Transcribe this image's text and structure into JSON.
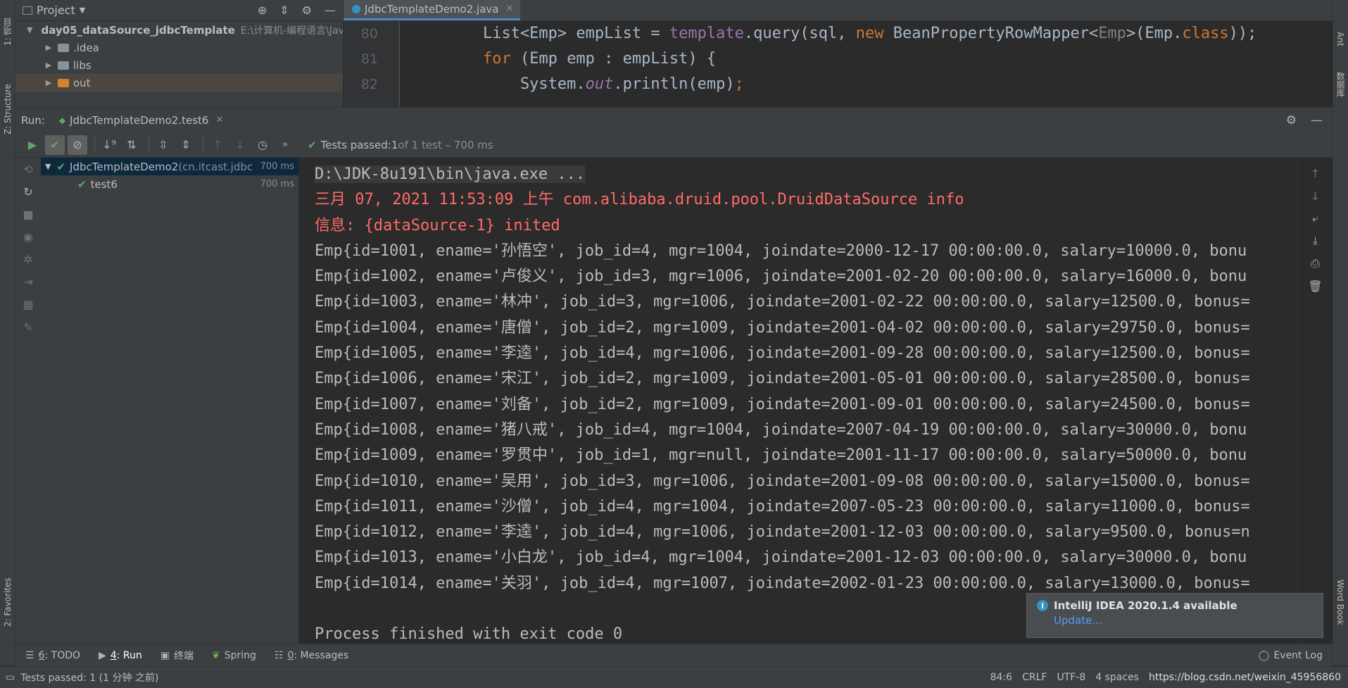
{
  "left_strip": {
    "project_tab": "1: 项目",
    "structure_tab": "Z: Structure",
    "favorites_tab": "2: Favorites"
  },
  "right_strip": {
    "ant_tab": "Ant",
    "database_tab": "数据库",
    "wordbook_tab": "Word Book"
  },
  "project": {
    "title": "Project",
    "tree": [
      {
        "label": "day05_dataSource_jdbcTemplate",
        "path": "E:\\计算机-编程语言\\Jav"
      },
      {
        "label": ".idea"
      },
      {
        "label": "libs"
      },
      {
        "label": "out"
      }
    ]
  },
  "editor": {
    "tab_label": "JdbcTemplateDemo2.java",
    "lines": [
      {
        "num": "80"
      },
      {
        "num": "81"
      },
      {
        "num": "82"
      }
    ]
  },
  "run": {
    "label": "Run:",
    "tab_label": "JdbcTemplateDemo2.test6",
    "status_prefix": "Tests passed: ",
    "status_count": "1",
    "status_suffix": " of 1 test – 700 ms",
    "tree": [
      {
        "label": "JdbcTemplateDemo2",
        "pkg": " (cn.itcast.jdbc",
        "duration": "700 ms"
      },
      {
        "label": "test6",
        "duration": "700 ms"
      }
    ]
  },
  "console": {
    "command": "D:\\JDK-8u191\\bin\\java.exe ...",
    "log_line1": "三月 07, 2021 11:53:09 上午 com.alibaba.druid.pool.DruidDataSource info",
    "log_line2": "信息: {dataSource-1} inited",
    "output": [
      "Emp{id=1001, ename='孙悟空', job_id=4, mgr=1004, joindate=2000-12-17 00:00:00.0, salary=10000.0, bonu",
      "Emp{id=1002, ename='卢俊义', job_id=3, mgr=1006, joindate=2001-02-20 00:00:00.0, salary=16000.0, bonu",
      "Emp{id=1003, ename='林冲', job_id=3, mgr=1006, joindate=2001-02-22 00:00:00.0, salary=12500.0, bonus=",
      "Emp{id=1004, ename='唐僧', job_id=2, mgr=1009, joindate=2001-04-02 00:00:00.0, salary=29750.0, bonus=",
      "Emp{id=1005, ename='李逵', job_id=4, mgr=1006, joindate=2001-09-28 00:00:00.0, salary=12500.0, bonus=",
      "Emp{id=1006, ename='宋江', job_id=2, mgr=1009, joindate=2001-05-01 00:00:00.0, salary=28500.0, bonus=",
      "Emp{id=1007, ename='刘备', job_id=2, mgr=1009, joindate=2001-09-01 00:00:00.0, salary=24500.0, bonus=",
      "Emp{id=1008, ename='猪八戒', job_id=4, mgr=1004, joindate=2007-04-19 00:00:00.0, salary=30000.0, bonu",
      "Emp{id=1009, ename='罗贯中', job_id=1, mgr=null, joindate=2001-11-17 00:00:00.0, salary=50000.0, bonu",
      "Emp{id=1010, ename='吴用', job_id=3, mgr=1006, joindate=2001-09-08 00:00:00.0, salary=15000.0, bonus=",
      "Emp{id=1011, ename='沙僧', job_id=4, mgr=1004, joindate=2007-05-23 00:00:00.0, salary=11000.0, bonus=",
      "Emp{id=1012, ename='李逵', job_id=4, mgr=1006, joindate=2001-12-03 00:00:00.0, salary=9500.0, bonus=n",
      "Emp{id=1013, ename='小白龙', job_id=4, mgr=1004, joindate=2001-12-03 00:00:00.0, salary=30000.0, bonu",
      "Emp{id=1014, ename='关羽', job_id=4, mgr=1007, joindate=2002-01-23 00:00:00.0, salary=13000.0, bonus="
    ],
    "finish": "Process finished with exit code 0"
  },
  "notification": {
    "title": "IntelliJ IDEA 2020.1.4 available",
    "link": "Update..."
  },
  "bottom_tabs": [
    {
      "key": "6",
      "label": ": TODO"
    },
    {
      "key": "4",
      "label": ": Run"
    },
    {
      "label": "终端"
    },
    {
      "label": "Spring"
    },
    {
      "key": "0",
      "label": ": Messages"
    },
    {
      "label": "Event Log"
    }
  ],
  "status_bar": {
    "left": "Tests passed: 1 (1 分钟 之前)",
    "position": "84:6",
    "line_sep": "CRLF",
    "encoding": "UTF-8",
    "indent": "4 spaces",
    "watermark": "https://blog.csdn.net/weixin_45956860"
  },
  "colors": {
    "accent": "#4a88c7",
    "pass_green": "#59a869",
    "error_red": "#ff6b68",
    "link_blue": "#589df6",
    "background": "#2b2b2b"
  }
}
